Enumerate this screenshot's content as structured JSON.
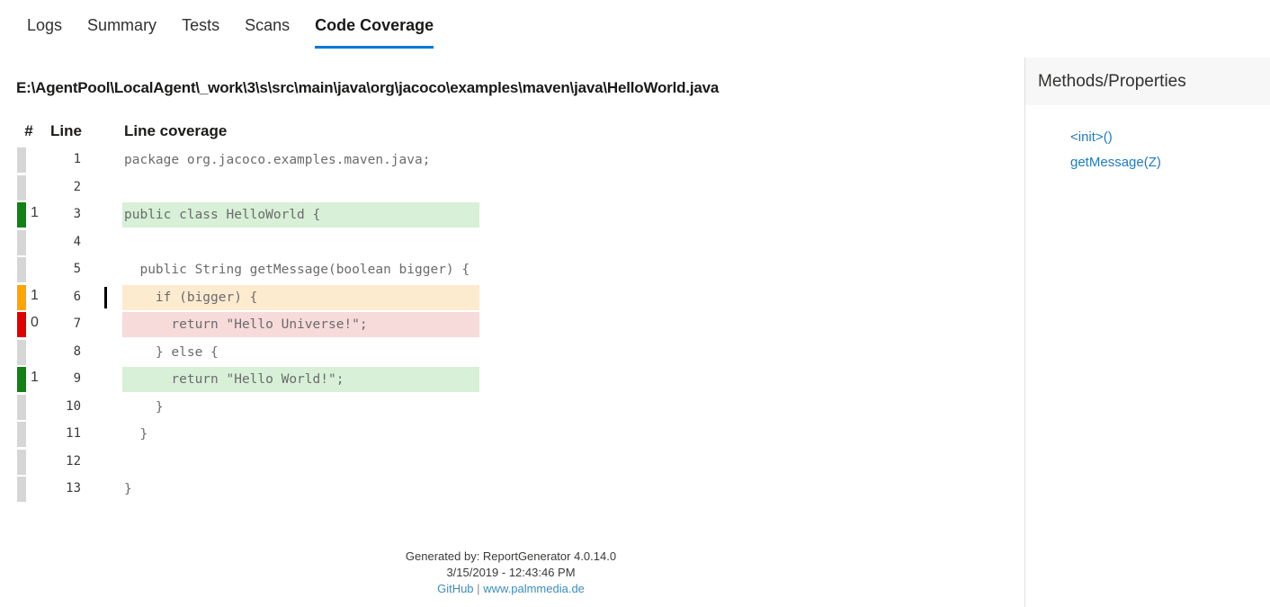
{
  "tabs": [
    {
      "label": "Logs",
      "active": false
    },
    {
      "label": "Summary",
      "active": false
    },
    {
      "label": "Tests",
      "active": false
    },
    {
      "label": "Scans",
      "active": false
    },
    {
      "label": "Code Coverage",
      "active": true
    }
  ],
  "file": {
    "path": "E:\\AgentPool\\LocalAgent\\_work\\3\\s\\src\\main\\java\\org\\jacoco\\examples\\maven\\java\\HelloWorld.java"
  },
  "table": {
    "headers": {
      "hits": "#",
      "line": "Line",
      "coverage": "Line coverage"
    },
    "rows": [
      {
        "hits": "",
        "line": "1",
        "code": "package org.jacoco.examples.maven.java;",
        "status": "none-bar",
        "branch": false
      },
      {
        "hits": "",
        "line": "2",
        "code": "",
        "status": "none-bar",
        "branch": false
      },
      {
        "hits": "1",
        "line": "3",
        "code": "public class HelloWorld {",
        "status": "full",
        "branch": false
      },
      {
        "hits": "",
        "line": "4",
        "code": "",
        "status": "none-bar",
        "branch": false
      },
      {
        "hits": "",
        "line": "5",
        "code": "  public String getMessage(boolean bigger) {",
        "status": "none-bar",
        "branch": false
      },
      {
        "hits": "1",
        "line": "6",
        "code": "    if (bigger) {",
        "status": "partial",
        "branch": true
      },
      {
        "hits": "0",
        "line": "7",
        "code": "      return \"Hello Universe!\";",
        "status": "uncovered",
        "branch": false
      },
      {
        "hits": "",
        "line": "8",
        "code": "    } else {",
        "status": "none-bar",
        "branch": false
      },
      {
        "hits": "1",
        "line": "9",
        "code": "      return \"Hello World!\";",
        "status": "full",
        "branch": false
      },
      {
        "hits": "",
        "line": "10",
        "code": "    }",
        "status": "none-bar",
        "branch": false
      },
      {
        "hits": "",
        "line": "11",
        "code": "  }",
        "status": "none-bar",
        "branch": false
      },
      {
        "hits": "",
        "line": "12",
        "code": "",
        "status": "none-bar",
        "branch": false
      },
      {
        "hits": "",
        "line": "13",
        "code": "}",
        "status": "none-bar",
        "branch": false
      }
    ]
  },
  "footer": {
    "generated_by": "Generated by: ReportGenerator 4.0.14.0",
    "timestamp": "3/15/2019 - 12:43:46 PM",
    "github_label": "GitHub",
    "separator": "|",
    "site_label": "www.palmmedia.de"
  },
  "sidebar": {
    "title": "Methods/Properties",
    "items": [
      {
        "label": "<init>()"
      },
      {
        "label": "getMessage(Z)"
      }
    ]
  },
  "colors": {
    "accent": "#0078d4",
    "covered": "#0f8214",
    "partial": "#ffa500",
    "uncovered": "#e00000",
    "neutral_bar": "#d6d6d6",
    "covered_bg": "#d7f0d7",
    "partial_bg": "#fdebd0",
    "uncovered_bg": "#f7dada",
    "link": "#1f7bc1"
  }
}
